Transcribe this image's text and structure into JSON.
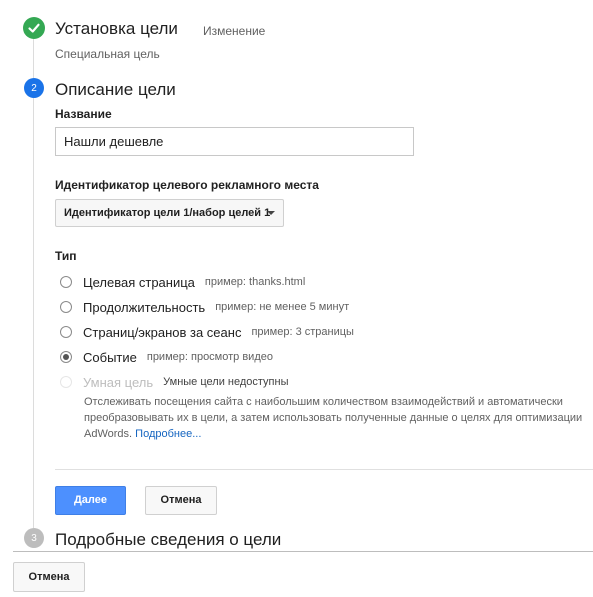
{
  "step1": {
    "number": "",
    "title": "Установка цели",
    "edit_label": "Изменение",
    "subtitle": "Специальная цель",
    "status_color": "#34a853"
  },
  "step2": {
    "number": "2",
    "title": "Описание цели",
    "status_color": "#1a73e8",
    "name_label": "Название",
    "name_value": "Нашли дешевле",
    "slot_label": "Идентификатор целевого рекламного места",
    "slot_value": "Идентификатор цели 1/набор целей 1",
    "type_label": "Тип",
    "types": [
      {
        "label": "Целевая страница",
        "hint": "пример: thanks.html",
        "checked": false,
        "disabled": false
      },
      {
        "label": "Продолжительность",
        "hint": "пример: не менее 5 минут",
        "checked": false,
        "disabled": false
      },
      {
        "label": "Страниц/экранов за сеанс",
        "hint": "пример: 3 страницы",
        "checked": false,
        "disabled": false
      },
      {
        "label": "Событие",
        "hint": "пример: просмотр видео",
        "checked": true,
        "disabled": false
      },
      {
        "label": "Умная цель",
        "hint": "Умные цели недоступны",
        "checked": false,
        "disabled": true
      }
    ],
    "smart_description": "Отслеживать посещения сайта с наибольшим количеством взаимодействий и автоматически преобразовывать их в цели, а затем использовать полученные данные о целях для оптимизации AdWords.",
    "learn_more": "Подробнее...",
    "continue_label": "Далее",
    "cancel_label": "Отмена"
  },
  "step3": {
    "number": "3",
    "title": "Подробные сведения о цели",
    "status_color": "#bdbdbd"
  },
  "footer": {
    "cancel_label": "Отмена"
  }
}
